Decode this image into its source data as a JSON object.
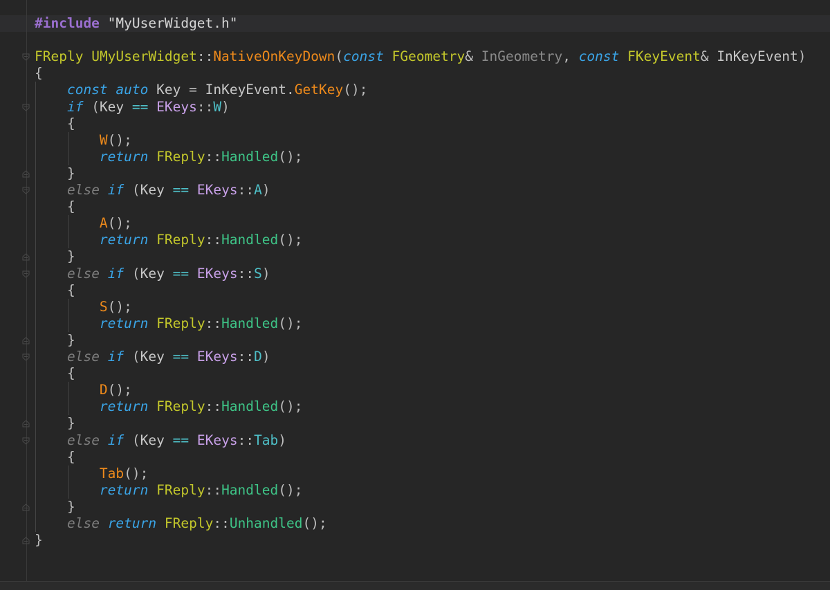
{
  "editor": {
    "lines": [
      [
        [
          "macro",
          "#include"
        ],
        [
          "plain",
          " "
        ],
        [
          "str",
          "\"MyUserWidget.h\""
        ]
      ],
      [],
      [
        [
          "type",
          "FReply"
        ],
        [
          "plain",
          " "
        ],
        [
          "type",
          "UMyUserWidget"
        ],
        [
          "punct",
          "::"
        ],
        [
          "fn",
          "NativeOnKeyDown"
        ],
        [
          "punct",
          "("
        ],
        [
          "kw",
          "const"
        ],
        [
          "plain",
          " "
        ],
        [
          "type",
          "FGeometry"
        ],
        [
          "punct",
          "&"
        ],
        [
          "plain",
          " "
        ],
        [
          "param",
          "InGeometry"
        ],
        [
          "punct",
          ", "
        ],
        [
          "kw",
          "const"
        ],
        [
          "plain",
          " "
        ],
        [
          "type",
          "FKeyEvent"
        ],
        [
          "punct",
          "&"
        ],
        [
          "plain",
          " "
        ],
        [
          "var",
          "InKeyEvent"
        ],
        [
          "punct",
          ")"
        ]
      ],
      [
        [
          "punct",
          "{"
        ]
      ],
      [
        [
          "plain",
          "    "
        ],
        [
          "kw",
          "const"
        ],
        [
          "plain",
          " "
        ],
        [
          "kw",
          "auto"
        ],
        [
          "plain",
          " "
        ],
        [
          "var",
          "Key"
        ],
        [
          "plain",
          " = "
        ],
        [
          "var",
          "InKeyEvent"
        ],
        [
          "punct",
          "."
        ],
        [
          "fn",
          "GetKey"
        ],
        [
          "punct",
          "();"
        ]
      ],
      [
        [
          "plain",
          "    "
        ],
        [
          "kw",
          "if"
        ],
        [
          "plain",
          " ("
        ],
        [
          "var",
          "Key"
        ],
        [
          "plain",
          " "
        ],
        [
          "eq",
          "=="
        ],
        [
          "plain",
          " "
        ],
        [
          "enum",
          "EKeys"
        ],
        [
          "punct",
          "::"
        ],
        [
          "member",
          "W"
        ],
        [
          "punct",
          ")"
        ]
      ],
      [
        [
          "plain",
          "    "
        ],
        [
          "punct",
          "{"
        ]
      ],
      [
        [
          "plain",
          "        "
        ],
        [
          "fn",
          "W"
        ],
        [
          "punct",
          "();"
        ]
      ],
      [
        [
          "plain",
          "        "
        ],
        [
          "kw",
          "return"
        ],
        [
          "plain",
          " "
        ],
        [
          "type",
          "FReply"
        ],
        [
          "punct",
          "::"
        ],
        [
          "static",
          "Handled"
        ],
        [
          "punct",
          "();"
        ]
      ],
      [
        [
          "plain",
          "    "
        ],
        [
          "punct",
          "}"
        ]
      ],
      [
        [
          "plain",
          "    "
        ],
        [
          "else",
          "else"
        ],
        [
          "plain",
          " "
        ],
        [
          "kw",
          "if"
        ],
        [
          "plain",
          " ("
        ],
        [
          "var",
          "Key"
        ],
        [
          "plain",
          " "
        ],
        [
          "eq",
          "=="
        ],
        [
          "plain",
          " "
        ],
        [
          "enum",
          "EKeys"
        ],
        [
          "punct",
          "::"
        ],
        [
          "member",
          "A"
        ],
        [
          "punct",
          ")"
        ]
      ],
      [
        [
          "plain",
          "    "
        ],
        [
          "punct",
          "{"
        ]
      ],
      [
        [
          "plain",
          "        "
        ],
        [
          "fn",
          "A"
        ],
        [
          "punct",
          "();"
        ]
      ],
      [
        [
          "plain",
          "        "
        ],
        [
          "kw",
          "return"
        ],
        [
          "plain",
          " "
        ],
        [
          "type",
          "FReply"
        ],
        [
          "punct",
          "::"
        ],
        [
          "static",
          "Handled"
        ],
        [
          "punct",
          "();"
        ]
      ],
      [
        [
          "plain",
          "    "
        ],
        [
          "punct",
          "}"
        ]
      ],
      [
        [
          "plain",
          "    "
        ],
        [
          "else",
          "else"
        ],
        [
          "plain",
          " "
        ],
        [
          "kw",
          "if"
        ],
        [
          "plain",
          " ("
        ],
        [
          "var",
          "Key"
        ],
        [
          "plain",
          " "
        ],
        [
          "eq",
          "=="
        ],
        [
          "plain",
          " "
        ],
        [
          "enum",
          "EKeys"
        ],
        [
          "punct",
          "::"
        ],
        [
          "member",
          "S"
        ],
        [
          "punct",
          ")"
        ]
      ],
      [
        [
          "plain",
          "    "
        ],
        [
          "punct",
          "{"
        ]
      ],
      [
        [
          "plain",
          "        "
        ],
        [
          "fn",
          "S"
        ],
        [
          "punct",
          "();"
        ]
      ],
      [
        [
          "plain",
          "        "
        ],
        [
          "kw",
          "return"
        ],
        [
          "plain",
          " "
        ],
        [
          "type",
          "FReply"
        ],
        [
          "punct",
          "::"
        ],
        [
          "static",
          "Handled"
        ],
        [
          "punct",
          "();"
        ]
      ],
      [
        [
          "plain",
          "    "
        ],
        [
          "punct",
          "}"
        ]
      ],
      [
        [
          "plain",
          "    "
        ],
        [
          "else",
          "else"
        ],
        [
          "plain",
          " "
        ],
        [
          "kw",
          "if"
        ],
        [
          "plain",
          " ("
        ],
        [
          "var",
          "Key"
        ],
        [
          "plain",
          " "
        ],
        [
          "eq",
          "=="
        ],
        [
          "plain",
          " "
        ],
        [
          "enum",
          "EKeys"
        ],
        [
          "punct",
          "::"
        ],
        [
          "member",
          "D"
        ],
        [
          "punct",
          ")"
        ]
      ],
      [
        [
          "plain",
          "    "
        ],
        [
          "punct",
          "{"
        ]
      ],
      [
        [
          "plain",
          "        "
        ],
        [
          "fn",
          "D"
        ],
        [
          "punct",
          "();"
        ]
      ],
      [
        [
          "plain",
          "        "
        ],
        [
          "kw",
          "return"
        ],
        [
          "plain",
          " "
        ],
        [
          "type",
          "FReply"
        ],
        [
          "punct",
          "::"
        ],
        [
          "static",
          "Handled"
        ],
        [
          "punct",
          "();"
        ]
      ],
      [
        [
          "plain",
          "    "
        ],
        [
          "punct",
          "}"
        ]
      ],
      [
        [
          "plain",
          "    "
        ],
        [
          "else",
          "else"
        ],
        [
          "plain",
          " "
        ],
        [
          "kw",
          "if"
        ],
        [
          "plain",
          " ("
        ],
        [
          "var",
          "Key"
        ],
        [
          "plain",
          " "
        ],
        [
          "eq",
          "=="
        ],
        [
          "plain",
          " "
        ],
        [
          "enum",
          "EKeys"
        ],
        [
          "punct",
          "::"
        ],
        [
          "member",
          "Tab"
        ],
        [
          "punct",
          ")"
        ]
      ],
      [
        [
          "plain",
          "    "
        ],
        [
          "punct",
          "{"
        ]
      ],
      [
        [
          "plain",
          "        "
        ],
        [
          "fn",
          "Tab"
        ],
        [
          "punct",
          "();"
        ]
      ],
      [
        [
          "plain",
          "        "
        ],
        [
          "kw",
          "return"
        ],
        [
          "plain",
          " "
        ],
        [
          "type",
          "FReply"
        ],
        [
          "punct",
          "::"
        ],
        [
          "static",
          "Handled"
        ],
        [
          "punct",
          "();"
        ]
      ],
      [
        [
          "plain",
          "    "
        ],
        [
          "punct",
          "}"
        ]
      ],
      [
        [
          "plain",
          "    "
        ],
        [
          "else",
          "else"
        ],
        [
          "plain",
          " "
        ],
        [
          "kw",
          "return"
        ],
        [
          "plain",
          " "
        ],
        [
          "type",
          "FReply"
        ],
        [
          "punct",
          "::"
        ],
        [
          "static",
          "Unhandled"
        ],
        [
          "punct",
          "();"
        ]
      ],
      [
        [
          "punct",
          "}"
        ]
      ]
    ],
    "fold_markers": [
      {
        "line": 2,
        "kind": "open"
      },
      {
        "line": 5,
        "kind": "open"
      },
      {
        "line": 9,
        "kind": "close"
      },
      {
        "line": 10,
        "kind": "open"
      },
      {
        "line": 14,
        "kind": "close"
      },
      {
        "line": 15,
        "kind": "open"
      },
      {
        "line": 19,
        "kind": "close"
      },
      {
        "line": 20,
        "kind": "open"
      },
      {
        "line": 24,
        "kind": "close"
      },
      {
        "line": 25,
        "kind": "open"
      },
      {
        "line": 29,
        "kind": "close"
      },
      {
        "line": 31,
        "kind": "close"
      }
    ],
    "colors": {
      "background": "#262626",
      "current_line": "#2d2d2f",
      "macro": "#9b6fd0",
      "type": "#c3c72b",
      "function": "#ee8a1b",
      "keyword": "#3aa4e6",
      "enum": "#c8a0e8",
      "member": "#4ec0c8",
      "static_method": "#3ec487"
    }
  }
}
